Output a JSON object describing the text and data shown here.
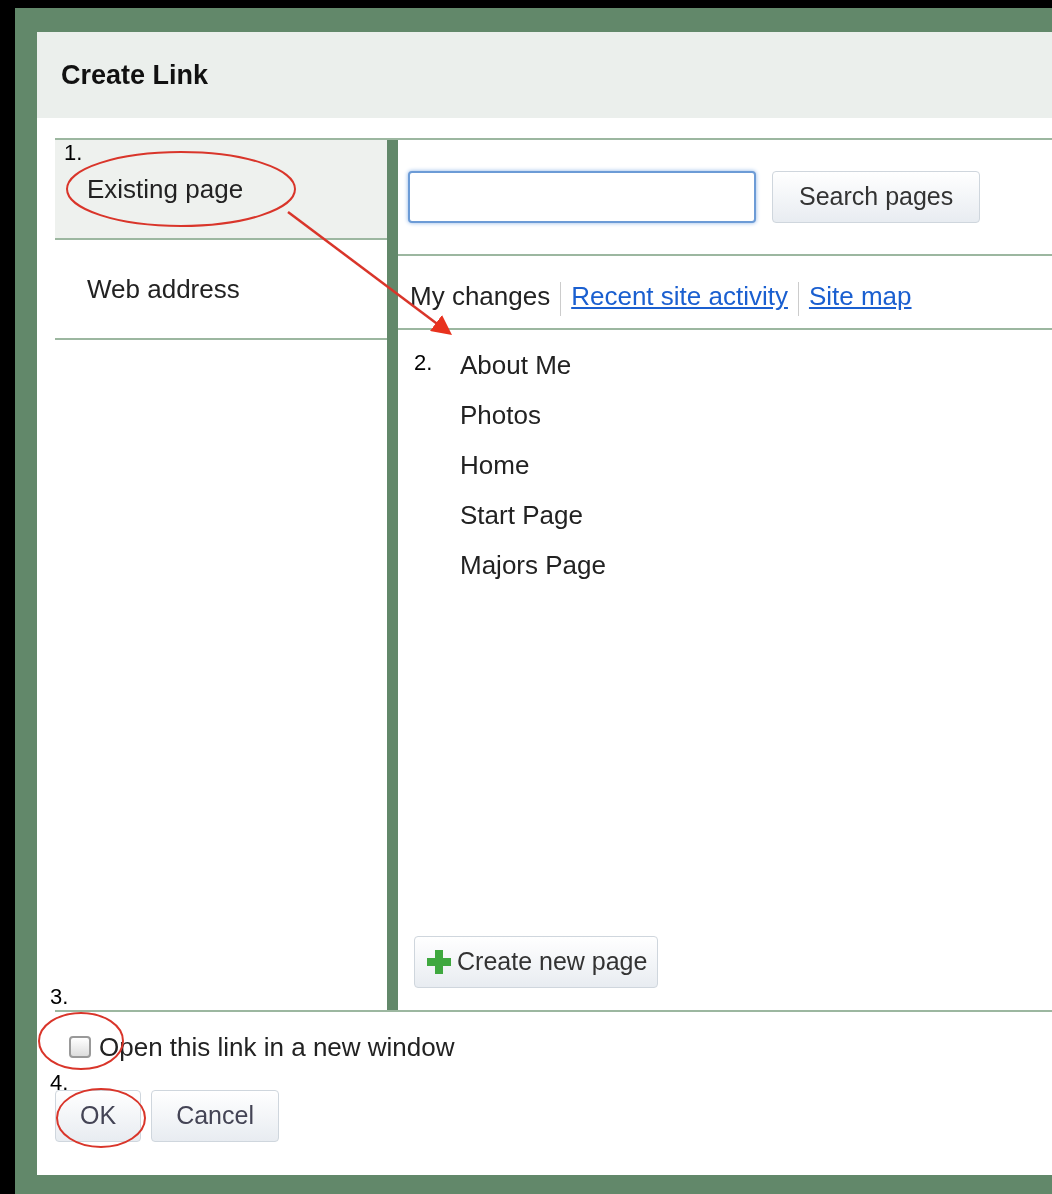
{
  "dialog": {
    "title": "Create Link"
  },
  "sidebar": {
    "items": [
      {
        "label": "Existing page",
        "selected": true
      },
      {
        "label": "Web address",
        "selected": false
      }
    ]
  },
  "search": {
    "button": "Search pages"
  },
  "tabs": [
    {
      "label": "My changes",
      "selected": true
    },
    {
      "label": "Recent site activity",
      "selected": false
    },
    {
      "label": "Site map",
      "selected": false
    }
  ],
  "pages": [
    "About Me",
    "Photos",
    "Home",
    "Start Page",
    "Majors Page"
  ],
  "create_button": "Create new page",
  "new_window": {
    "label": "Open this link in a new window",
    "checked": false
  },
  "buttons": [
    "OK",
    "Cancel"
  ],
  "annotations": [
    "1.",
    "2.",
    "3.",
    "4."
  ]
}
